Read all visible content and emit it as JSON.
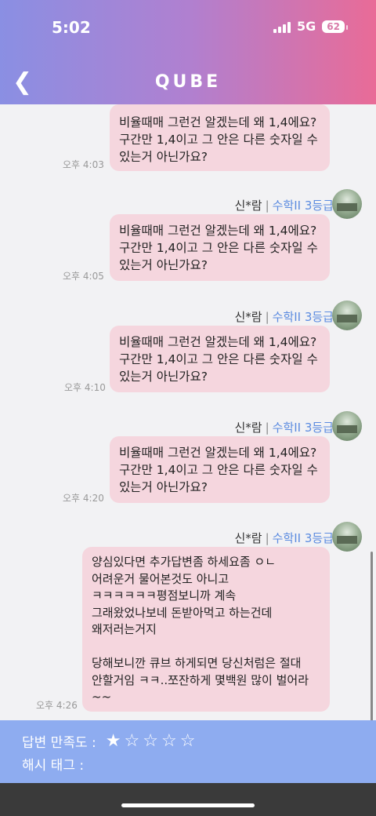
{
  "status_bar": {
    "time": "5:02",
    "network": "5G",
    "battery": "62"
  },
  "header": {
    "title": "QUBE"
  },
  "messages": [
    {
      "text": "비율때매 그런건 알겠는데 왜 1,4에요?\n구간만 1,4이고 그 안은 다른 숫자일 수\n있는거 아닌가요?",
      "time": "오후 4:03"
    },
    {
      "sender_name": "신*람",
      "sep": "|",
      "grade": "수학II 3등급",
      "text": "비율때매 그런건 알겠는데 왜 1,4에요?\n구간만 1,4이고 그 안은 다른 숫자일 수\n있는거 아닌가요?",
      "time": "오후 4:05"
    },
    {
      "sender_name": "신*람",
      "sep": "|",
      "grade": "수학II 3등급",
      "text": "비율때매 그런건 알겠는데 왜 1,4에요?\n구간만 1,4이고 그 안은 다른 숫자일 수\n있는거 아닌가요?",
      "time": "오후 4:10"
    },
    {
      "sender_name": "신*람",
      "sep": "|",
      "grade": "수학II 3등급",
      "text": "비율때매 그런건 알겠는데 왜 1,4에요?\n구간만 1,4이고 그 안은 다른 숫자일 수\n있는거 아닌가요?",
      "time": "오후 4:20"
    },
    {
      "sender_name": "신*람",
      "sep": "|",
      "grade": "수학II 3등급",
      "text": "양심있다면 추가답변좀 하세요좀 ㅇㄴ\n어려운거 물어본것도 아니고\nㅋㅋㅋㅋㅋㅋ평점보니까 계속\n그래왔었나보네 돈받아먹고 하는건데\n왜저러는거지\n\n당해보니깐 큐브 하게되면 당신처럼은 절대\n안할거임 ㅋㅋ..쪼잔하게 몇백원 많이 벌어라\n~~",
      "time": "오후 4:26"
    }
  ],
  "footer": {
    "rating_label": "답변 만족도 :",
    "rating_value": 1,
    "rating_max": 5,
    "stars": [
      "★",
      "☆",
      "☆",
      "☆",
      "☆"
    ],
    "hashtag_label": "해시 태그 :"
  },
  "colors": {
    "bubble": "#f5d6de",
    "footer": "#8eacf0",
    "grade": "#5b8be0"
  }
}
